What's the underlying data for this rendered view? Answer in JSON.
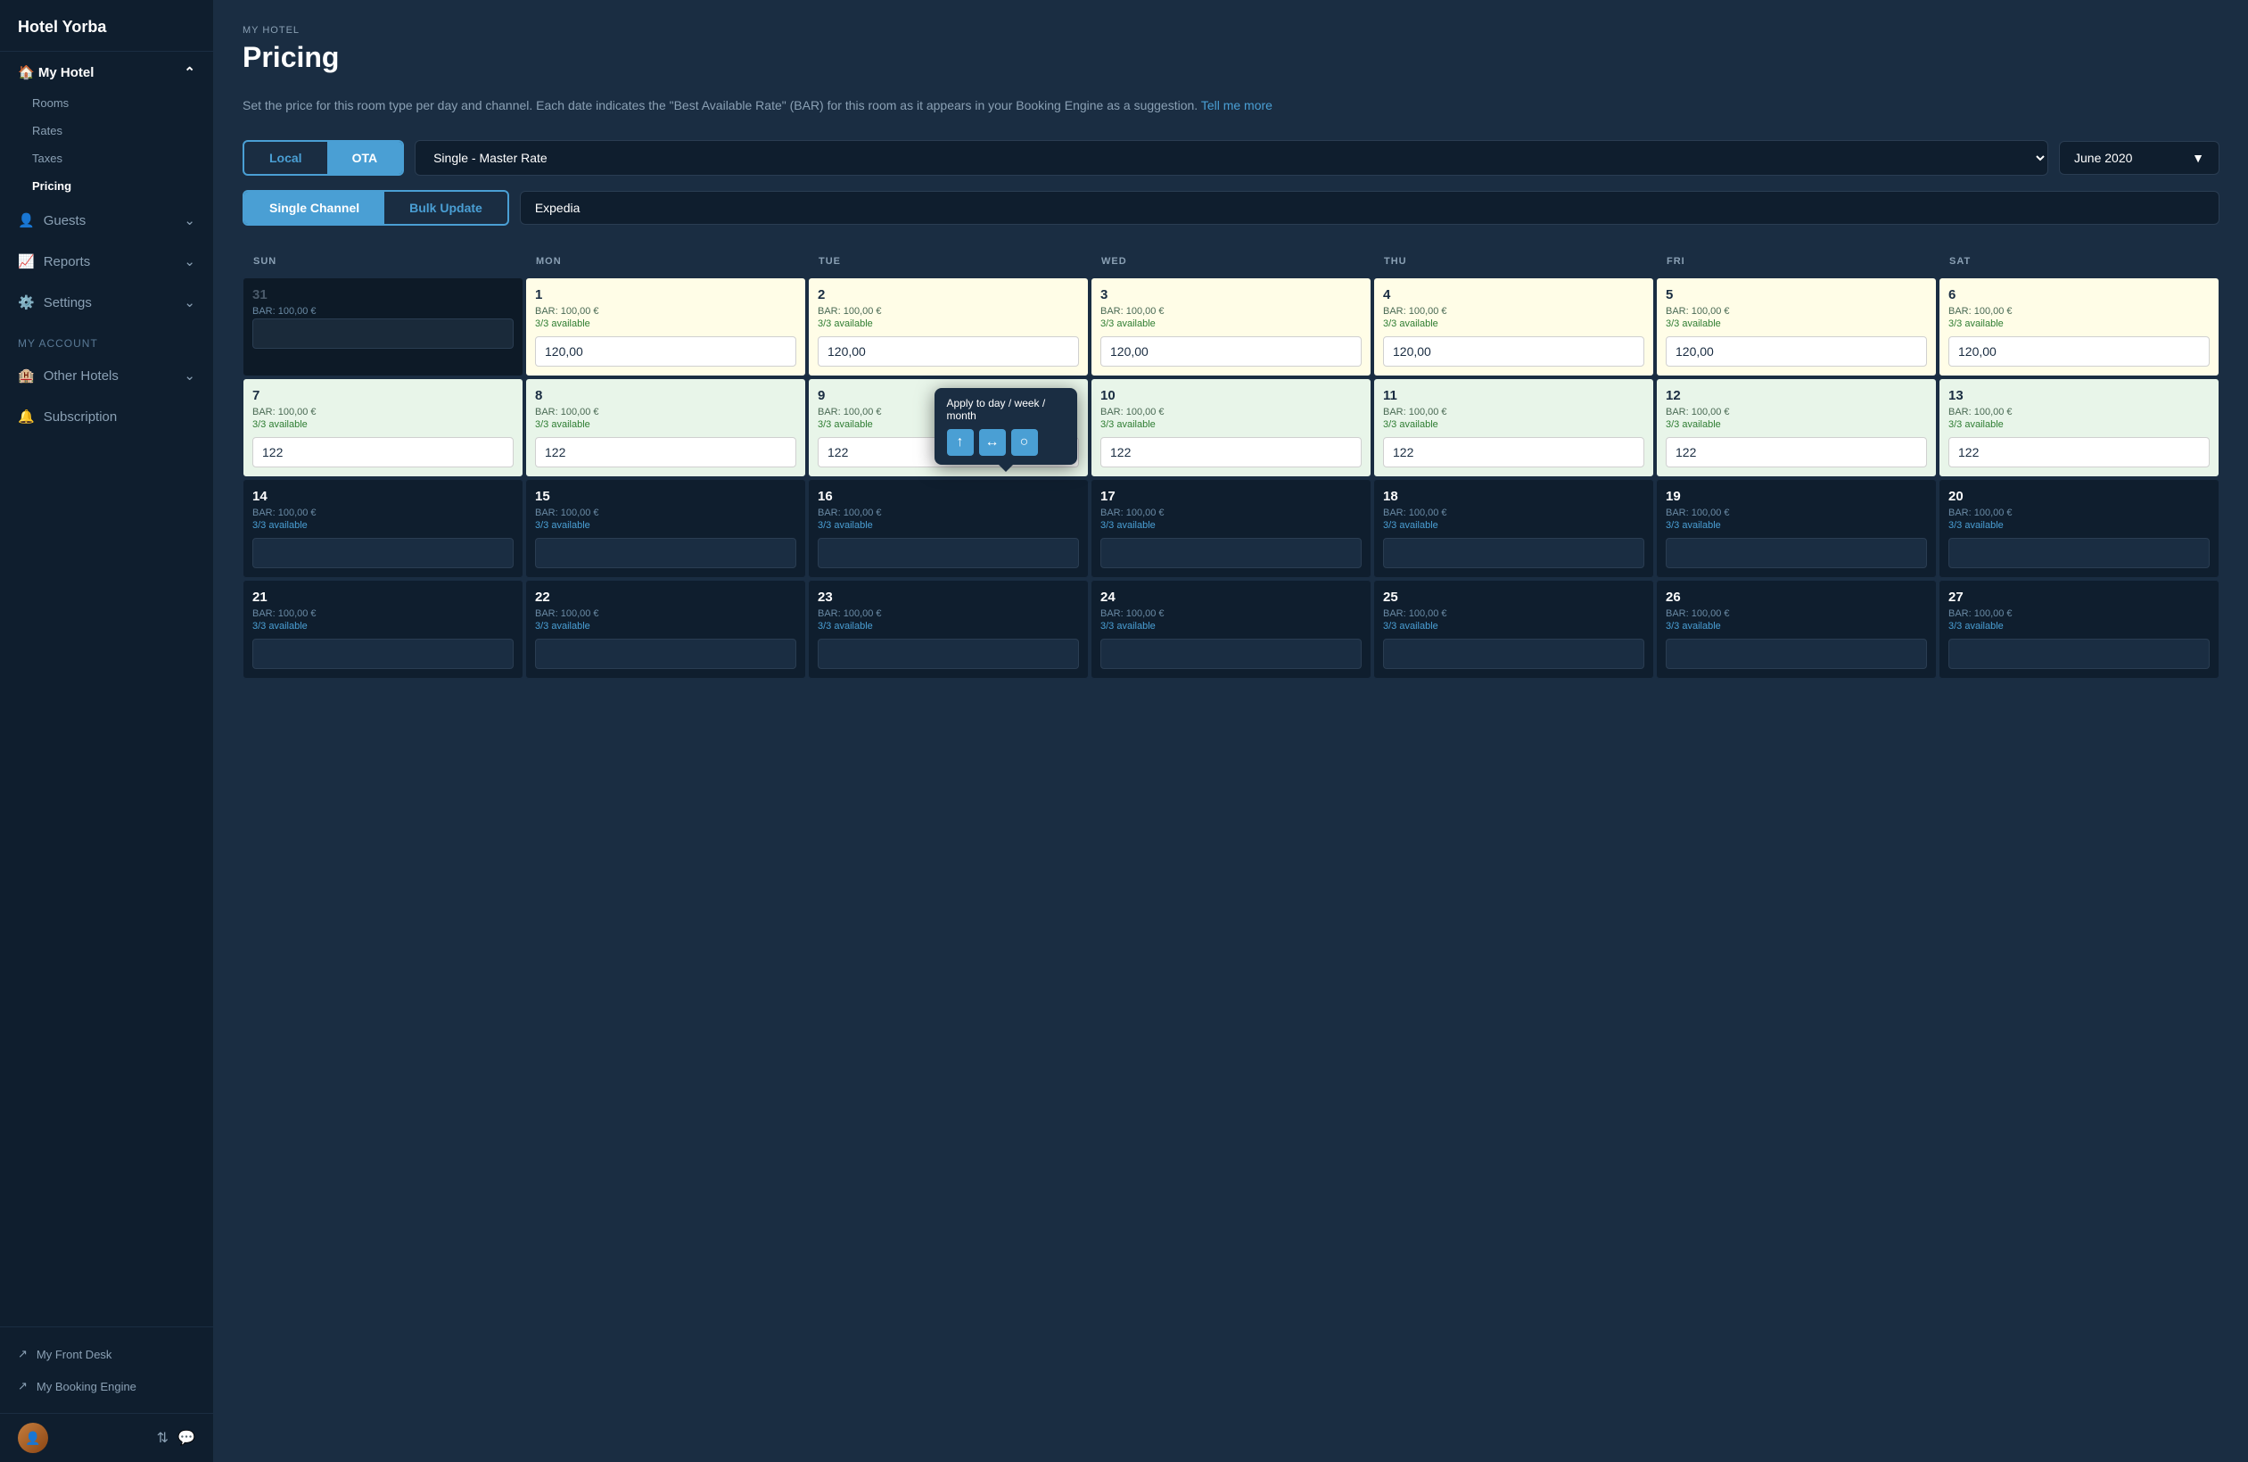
{
  "sidebar": {
    "logo": "Hotel Yorba",
    "sections": [
      {
        "name": "my-hotel",
        "label": "My Hotel",
        "expanded": true,
        "items": [
          "Rooms",
          "Rates",
          "Taxes",
          "Pricing"
        ]
      }
    ],
    "items": [
      {
        "id": "guests",
        "label": "Guests",
        "icon": "👤"
      },
      {
        "id": "reports",
        "label": "Reports",
        "icon": "📈"
      },
      {
        "id": "settings",
        "label": "Settings",
        "icon": "⚙️"
      }
    ],
    "account_label": "MY ACCOUNT",
    "account_items": [
      {
        "id": "other-hotels",
        "label": "Other Hotels",
        "icon": "🏨"
      },
      {
        "id": "subscription",
        "label": "Subscription",
        "icon": "🔔"
      }
    ],
    "bottom_links": [
      {
        "id": "front-desk",
        "label": "My Front Desk",
        "icon": "↗"
      },
      {
        "id": "booking-engine",
        "label": "My Booking Engine",
        "icon": "↗"
      }
    ]
  },
  "breadcrumb": "MY HOTEL",
  "page_title": "Pricing",
  "description": "Set the price for this room type per day and channel. Each date indicates the \"Best Available Rate\" (BAR) for this room as it appears in your Booking Engine as a suggestion.",
  "tell_more": "Tell me more",
  "tabs": {
    "local_label": "Local",
    "ota_label": "OTA"
  },
  "rate_select": "Single - Master Rate",
  "month_select": "June 2020",
  "channel_tabs": {
    "single_label": "Single Channel",
    "bulk_label": "Bulk Update"
  },
  "channel_name": "Expedia",
  "day_headers": [
    "SUN",
    "MON",
    "TUE",
    "WED",
    "THU",
    "FRI",
    "SAT"
  ],
  "weeks": [
    {
      "days": [
        {
          "num": "31",
          "bar": "BAR: 100,00 €",
          "avail": "",
          "value": "",
          "type": "inactive"
        },
        {
          "num": "1",
          "bar": "BAR: 100,00 €",
          "avail": "3/3 available",
          "value": "120,00",
          "type": "highlighted"
        },
        {
          "num": "2",
          "bar": "BAR: 100,00 €",
          "avail": "3/3 available",
          "value": "120,00",
          "type": "highlighted"
        },
        {
          "num": "3",
          "bar": "BAR: 100,00 €",
          "avail": "3/3 available",
          "value": "120,00",
          "type": "highlighted"
        },
        {
          "num": "4",
          "bar": "BAR: 100,00 €",
          "avail": "3/3 available",
          "value": "120,00",
          "type": "highlighted"
        },
        {
          "num": "5",
          "bar": "BAR: 100,00 €",
          "avail": "3/3 available",
          "value": "120,00",
          "type": "highlighted"
        },
        {
          "num": "6",
          "bar": "BAR: 100,00 €",
          "avail": "3/3 available",
          "value": "120,00",
          "type": "highlighted"
        }
      ]
    },
    {
      "days": [
        {
          "num": "7",
          "bar": "BAR: 100,00 €",
          "avail": "3/3 available",
          "value": "122",
          "type": "light-green",
          "tooltip": true
        },
        {
          "num": "8",
          "bar": "BAR: 100,00 €",
          "avail": "3/3 available",
          "value": "122",
          "type": "light-green"
        },
        {
          "num": "9",
          "bar": "BAR: 100,00 €",
          "avail": "3/3 available",
          "value": "122",
          "type": "light-green",
          "has_tooltip": true
        },
        {
          "num": "10",
          "bar": "BAR: 100,00 €",
          "avail": "3/3 available",
          "value": "122",
          "type": "light-green"
        },
        {
          "num": "11",
          "bar": "BAR: 100,00 €",
          "avail": "3/3 available",
          "value": "122",
          "type": "light-green"
        },
        {
          "num": "12",
          "bar": "BAR: 100,00 €",
          "avail": "3/3 available",
          "value": "122",
          "type": "light-green"
        },
        {
          "num": "13",
          "bar": "BAR: 100,00 €",
          "avail": "3/3 available",
          "value": "122",
          "type": "light-green"
        }
      ]
    },
    {
      "days": [
        {
          "num": "14",
          "bar": "BAR: 100,00 €",
          "avail": "3/3 available",
          "value": "",
          "type": "normal"
        },
        {
          "num": "15",
          "bar": "BAR: 100,00 €",
          "avail": "3/3 available",
          "value": "",
          "type": "normal"
        },
        {
          "num": "16",
          "bar": "BAR: 100,00 €",
          "avail": "3/3 available",
          "value": "",
          "type": "normal"
        },
        {
          "num": "17",
          "bar": "BAR: 100,00 €",
          "avail": "3/3 available",
          "value": "",
          "type": "normal"
        },
        {
          "num": "18",
          "bar": "BAR: 100,00 €",
          "avail": "3/3 available",
          "value": "",
          "type": "normal"
        },
        {
          "num": "19",
          "bar": "BAR: 100,00 €",
          "avail": "3/3 available",
          "value": "",
          "type": "normal"
        },
        {
          "num": "20",
          "bar": "BAR: 100,00 €",
          "avail": "3/3 available",
          "value": "",
          "type": "normal"
        }
      ]
    },
    {
      "days": [
        {
          "num": "21",
          "bar": "BAR: 100,00 €",
          "avail": "3/3 available",
          "value": "",
          "type": "normal"
        },
        {
          "num": "22",
          "bar": "BAR: 100,00 €",
          "avail": "3/3 available",
          "value": "",
          "type": "normal"
        },
        {
          "num": "23",
          "bar": "BAR: 100,00 €",
          "avail": "3/3 available",
          "value": "",
          "type": "normal"
        },
        {
          "num": "24",
          "bar": "BAR: 100,00 €",
          "avail": "3/3 available",
          "value": "",
          "type": "normal"
        },
        {
          "num": "25",
          "bar": "BAR: 100,00 €",
          "avail": "3/3 available",
          "value": "",
          "type": "normal"
        },
        {
          "num": "26",
          "bar": "BAR: 100,00 €",
          "avail": "3/3 available",
          "value": "",
          "type": "normal"
        },
        {
          "num": "27",
          "bar": "BAR: 100,00 €",
          "avail": "3/3 available",
          "value": "",
          "type": "normal"
        }
      ]
    }
  ],
  "tooltip": {
    "title": "Apply to day / week / month",
    "btn_up": "↑",
    "btn_lr": "↔",
    "btn_circle": "○"
  }
}
